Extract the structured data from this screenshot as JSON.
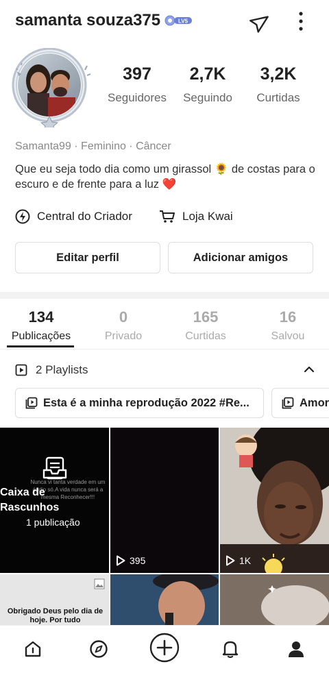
{
  "header": {
    "username": "samanta souza375",
    "level_badge": "LV5"
  },
  "profile": {
    "stats": [
      {
        "value": "397",
        "label": "Seguidores"
      },
      {
        "value": "2,7K",
        "label": "Seguindo"
      },
      {
        "value": "3,2K",
        "label": "Curtidas"
      }
    ],
    "meta": "Samanta99 · Feminino · Câncer",
    "bio": "Que eu seja todo dia como um girassol 🌻 de costas para o escuro e de frente para a luz ❤️"
  },
  "quick_links": {
    "creator_center": "Central do Criador",
    "kwai_store": "Loja Kwai"
  },
  "actions": {
    "edit_profile": "Editar perfil",
    "add_friends": "Adicionar amigos"
  },
  "tabs": [
    {
      "count": "134",
      "label": "Publicações",
      "active": true
    },
    {
      "count": "0",
      "label": "Privado",
      "active": false
    },
    {
      "count": "165",
      "label": "Curtidas",
      "active": false
    },
    {
      "count": "16",
      "label": "Salvou",
      "active": false
    }
  ],
  "playlists": {
    "header": "2 Playlists",
    "items": [
      "Esta é a minha reprodução 2022 #Re...",
      "Amor"
    ]
  },
  "grid": {
    "drafts": {
      "title": "Caixa de Rascunhos",
      "count": "1 publicação",
      "faint_text": "Nunca vi tanta verdade em um áudio só.A vida nunca será a mesma Reconhecer!!!"
    },
    "videos": [
      {
        "views": "395"
      },
      {
        "views": "1K"
      }
    ],
    "thanks_text": "Obrigado Deus pelo dia de hoje. Por tudo"
  },
  "colors": {
    "text_primary": "#222222",
    "text_secondary": "#888888",
    "divider": "#eeeeee",
    "heart": "#e0253a",
    "badge": "#6a7fd6"
  }
}
